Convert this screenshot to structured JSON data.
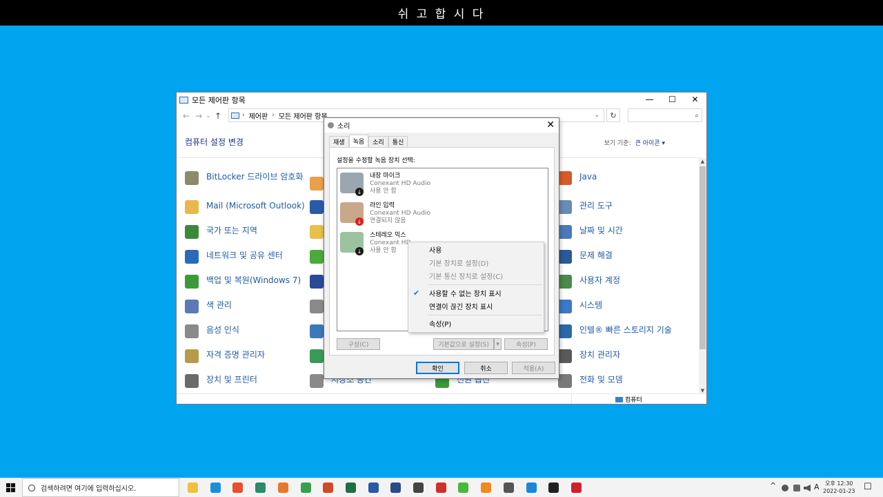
{
  "banner": "쉬 고 합 시 다",
  "control_panel": {
    "title": "모든 제어판 항목",
    "window_controls": {
      "minimize": "—",
      "maximize": "☐",
      "close": "✕"
    },
    "nav": {
      "back": "←",
      "forward": "→",
      "recent": "⌄",
      "up": "↑"
    },
    "breadcrumb": [
      "제어판",
      "모든 제어판 항목"
    ],
    "breadcrumb_sep": "›",
    "address_dropdown": "⌄",
    "refresh": "↻",
    "search_icon": "⌕",
    "heading": "컴퓨터 설정 변경",
    "view_by_label": "보기 기준:",
    "view_by_value": "큰 아이콘 ▾",
    "scroll_up": "▲",
    "scroll_down": "▼",
    "status_item": "컴퓨터",
    "items": [
      {
        "label": "BitLocker 드라이브 암호화",
        "icon": "key-icon",
        "color": "#8b8b6a"
      },
      {
        "label": "Mail (Microsoft Outlook)",
        "icon": "folder-icon",
        "color": "#e8b84a"
      },
      {
        "label": "국가 또는 지역",
        "icon": "globe-clock-icon",
        "color": "#3a8a3a"
      },
      {
        "label": "네트워크 및 공유 센터",
        "icon": "network-icon",
        "color": "#2a6ab8"
      },
      {
        "label": "백업 및 복원(Windows 7)",
        "icon": "backup-icon",
        "color": "#3a9a3a"
      },
      {
        "label": "색 관리",
        "icon": "color-management-icon",
        "color": "#5a7ab8"
      },
      {
        "label": "음성 인식",
        "icon": "microphone-icon",
        "color": "#8a8a8a"
      },
      {
        "label": "자격 증명 관리자",
        "icon": "credential-icon",
        "color": "#b89a4a"
      },
      {
        "label": "장치 및 프린터",
        "icon": "printer-icon",
        "color": "#6a6a6a"
      },
      {
        "label": "Java",
        "icon": "java-icon",
        "color": "#d65a2a"
      },
      {
        "label": "관리 도구",
        "icon": "admin-tools-icon",
        "color": "#6a8ab8"
      },
      {
        "label": "날짜 및 시간",
        "icon": "calendar-clock-icon",
        "color": "#4a7ab8"
      },
      {
        "label": "문제 해결",
        "icon": "troubleshoot-icon",
        "color": "#2a5a98"
      },
      {
        "label": "사용자 계정",
        "icon": "users-icon",
        "color": "#4a8a4a"
      },
      {
        "label": "시스템",
        "icon": "system-icon",
        "color": "#3a7ac8"
      },
      {
        "label": "인텔® 빠른 스토리지 기술",
        "icon": "intel-storage-icon",
        "color": "#2a6aa8"
      },
      {
        "label": "장치 관리자",
        "icon": "device-manager-icon",
        "color": "#5a5a5a"
      },
      {
        "label": "전화 및 모뎀",
        "icon": "phone-icon",
        "color": "#7a7a7a"
      }
    ],
    "partial_items": [
      {
        "label": "저장소 공간",
        "icon": "storage-spaces-icon",
        "color": "#8a8a8a"
      },
      {
        "label": "전원 옵션",
        "icon": "power-icon",
        "color": "#3a9a3a"
      }
    ],
    "col2_icons": [
      {
        "icon": "drive-icon",
        "color": "#e8a04a"
      },
      {
        "icon": "remote-icon",
        "color": "#2a5aa8"
      },
      {
        "icon": "fonts-icon",
        "color": "#e8c04a"
      },
      {
        "icon": "sync-icon",
        "color": "#4aaa3a"
      },
      {
        "icon": "flag-icon",
        "color": "#2a4a98"
      },
      {
        "icon": "search-folder-icon",
        "color": "#8a8a8a"
      },
      {
        "icon": "globe-icon",
        "color": "#3a7ab8"
      },
      {
        "icon": "media-icon",
        "color": "#3a9a5a"
      }
    ]
  },
  "sound_dialog": {
    "title": "소리",
    "close": "✕",
    "tabs": [
      "재생",
      "녹음",
      "소리",
      "통신"
    ],
    "active_tab": "녹음",
    "instruction": "설정을 수정할 녹음 장치 선택:",
    "devices": [
      {
        "name": "내장 마이크",
        "driver": "Conexant HD Audio",
        "status": "사용 안 함",
        "badge": "↓",
        "badge_color": "#1a1a1a"
      },
      {
        "name": "라인 입력",
        "driver": "Conexant HD Audio",
        "status": "연결되지 않음",
        "badge": "↓",
        "badge_color": "#d92020"
      },
      {
        "name": "스테레오 믹스",
        "driver": "Conexant HD",
        "status": "사용 안 함",
        "badge": "↓",
        "badge_color": "#1a1a1a"
      }
    ],
    "configure": "구성(C)",
    "set_default": "기본값으로 설정(S)",
    "set_default_arrow": "▾",
    "properties": "속성(P)",
    "ok": "확인",
    "cancel": "취소",
    "apply": "적용(A)"
  },
  "context_menu": {
    "check_mark": "✔",
    "items": [
      {
        "label": "사용",
        "enabled": true,
        "checked": false
      },
      {
        "label": "기본 장치로 설정(D)",
        "enabled": false,
        "checked": false
      },
      {
        "label": "기본 통신 장치로 설정(C)",
        "enabled": false,
        "checked": false
      },
      {
        "label": "사용할 수 없는 장치 표시",
        "enabled": true,
        "checked": true
      },
      {
        "label": "연결이 끊긴 장치 표시",
        "enabled": true,
        "checked": false
      },
      {
        "label": "속성(P)",
        "enabled": true,
        "checked": false
      }
    ]
  },
  "taskbar": {
    "search_placeholder": "검색하려면 여기에 입력하십시오.",
    "apps": [
      {
        "icon": "file-explorer-icon",
        "color": "#f0c040"
      },
      {
        "icon": "edge-icon",
        "color": "#1b8fd8"
      },
      {
        "icon": "brave-icon",
        "color": "#e8502a"
      },
      {
        "icon": "app-green-icon",
        "color": "#2a8a6a"
      },
      {
        "icon": "firefox-icon",
        "color": "#e8782a"
      },
      {
        "icon": "chrome-icon",
        "color": "#3aa04a"
      },
      {
        "icon": "powerpoint-icon",
        "color": "#d04a2a"
      },
      {
        "icon": "excel-icon",
        "color": "#1d7044"
      },
      {
        "icon": "word-icon",
        "color": "#2a5aa8"
      },
      {
        "icon": "app-blue-icon",
        "color": "#2a4a88"
      },
      {
        "icon": "search-app-icon",
        "color": "#444444"
      },
      {
        "icon": "app-red-icon",
        "color": "#d0302a"
      },
      {
        "icon": "app-green2-icon",
        "color": "#4ab83a"
      },
      {
        "icon": "vlc-icon",
        "color": "#f08a1a"
      },
      {
        "icon": "calculator-icon",
        "color": "#555555"
      },
      {
        "icon": "app-ie-icon",
        "color": "#1a88d8"
      },
      {
        "icon": "app-black-icon",
        "color": "#222222"
      },
      {
        "icon": "opera-icon",
        "color": "#d0202a"
      }
    ],
    "tray": {
      "chevron": "^",
      "ime": "A"
    },
    "time": "오후 12:30",
    "date": "2022-01-23",
    "notification_icon": "☐"
  }
}
